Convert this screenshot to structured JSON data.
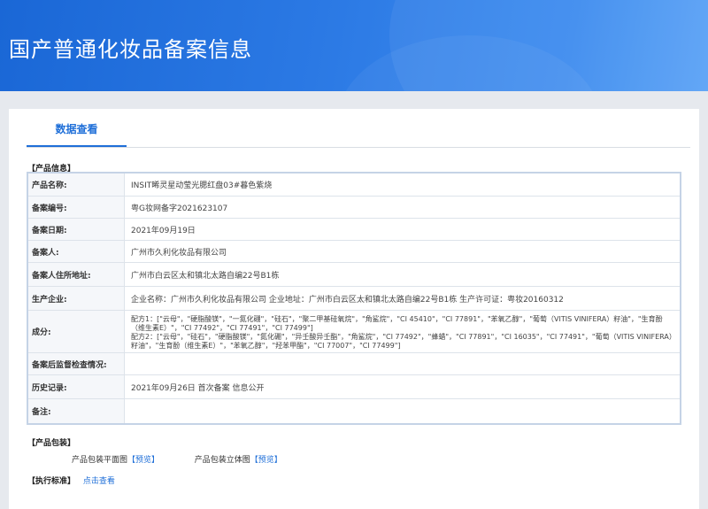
{
  "banner": {
    "title": "国产普通化妆品备案信息"
  },
  "tabs": [
    {
      "label": "数据查看"
    }
  ],
  "product_info": {
    "section_title": "【产品信息】",
    "rows": [
      {
        "label": "产品名称:",
        "value": "INSIT晞灵星动莹光腮红盘03#暮色紫烧"
      },
      {
        "label": "备案编号:",
        "value": "粤G妆网备字2021623107"
      },
      {
        "label": "备案日期:",
        "value": "2021年09月19日"
      },
      {
        "label": "备案人:",
        "value": "广州市久利化妆品有限公司"
      },
      {
        "label": "备案人住所地址:",
        "value": "广州市白云区太和镇北太路自编22号B1栋"
      },
      {
        "label": "生产企业:",
        "value": "企业名称：广州市久利化妆品有限公司 企业地址：广州市白云区太和镇北太路自编22号B1栋 生产许可证：粤妆20160312"
      },
      {
        "label": "成分:",
        "value": "配方1：[\"云母\"，\"硬脂酸镁\"，\"一氮化硼\"，\"硅石\"，\"聚二甲基硅氧烷\"，\"角鲨烷\"，\"CI 45410\"，\"CI 77891\"，\"苯氧乙醇\"，\"葡萄（VITIS VINIFERA）籽油\"，\"生育酚（维生素E）\"，\"CI 77492\"，\"CI 77491\"，\"CI 77499\"]\n配方2：[\"云母\"，\"硅石\"，\"硬脂酸镁\"，\"氮化硼\"，\"异壬酸异壬酯\"，\"角鲨烷\"，\"CI 77492\"，\"蜂蜡\"，\"CI 77891\"，\"CI 16035\"，\"CI 77491\"，\"葡萄（VITIS VINIFERA）籽油\"，\"生育酚（维生素E）\"，\"苯氧乙醇\"，\"羟苯甲酯\"，\"CI 77007\"，\"CI 77499\"]"
      },
      {
        "label": "备案后监督检查情况:",
        "value": ""
      },
      {
        "label": "历史记录:",
        "value": "2021年09月26日 首次备案 信息公开"
      },
      {
        "label": "备注:",
        "value": ""
      }
    ]
  },
  "packaging": {
    "section_title": "【产品包装】",
    "flat_label": "产品包装平面图",
    "flat_link": "【预览】",
    "solid_label": "产品包装立体图",
    "solid_link": "【预览】"
  },
  "standard": {
    "section_title": "【执行标准】",
    "link": "点击查看"
  }
}
